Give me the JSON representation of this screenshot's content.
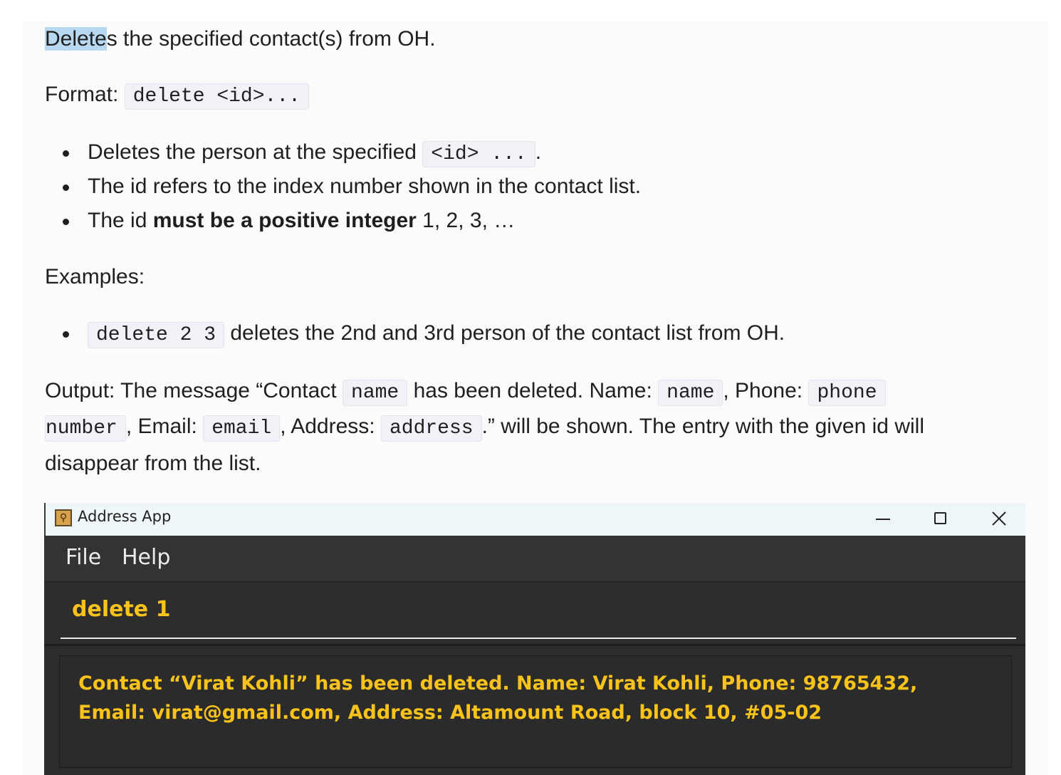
{
  "intro": {
    "highlight": "Delete",
    "rest": "s the specified contact(s) from OH."
  },
  "format": {
    "label": "Format:",
    "code": "delete <id>..."
  },
  "notes": {
    "item1": {
      "text": "Deletes the person at the specified",
      "code": "<id> ...",
      "suffix": "."
    },
    "item2": {
      "text": "The id refers to the index number shown in the contact list."
    },
    "item3": {
      "prefix": "The id",
      "bold": "must be a positive integer",
      "suffix": "1, 2, 3, …"
    }
  },
  "examples": {
    "label": "Examples:",
    "item1": {
      "code": "delete 2 3",
      "text": "deletes the 2nd and 3rd person of the contact list from OH."
    }
  },
  "output": {
    "p1": "Output: The message “Contact",
    "c1": "name",
    "p2": "has been deleted. Name:",
    "c2": "name",
    "p3": ", Phone:",
    "c3a": "phone",
    "c3b": "number",
    "p4": ", Email:",
    "c4": "email",
    "p5": ", Address:",
    "c5": "address",
    "p6": ".” will be shown. The entry with the given id will",
    "p7": "disappear from the list."
  },
  "app": {
    "title": "Address App",
    "menu": {
      "file": "File",
      "help": "Help"
    },
    "command": "delete 1",
    "result_line1": "Contact “Virat Kohli” has been deleted. Name: Virat Kohli, Phone: 98765432,",
    "result_line2": "Email: virat@gmail.com, Address: Altamount Road, block 10, #05-02",
    "icons": {
      "app": "address-book-icon",
      "minimize": "minimize-icon",
      "maximize": "maximize-icon",
      "close": "close-icon"
    },
    "accent_color": "#f9c31b"
  }
}
